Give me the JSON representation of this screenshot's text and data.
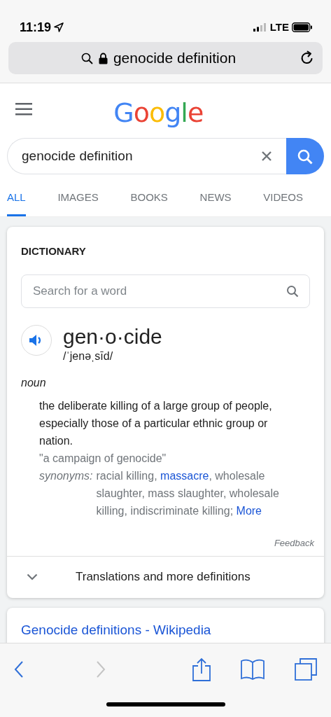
{
  "status_bar": {
    "time": "11:19",
    "network": "LTE"
  },
  "address_bar": {
    "text": "genocide definition",
    "secure": true
  },
  "header": {
    "logo": "Google"
  },
  "search": {
    "value": "genocide definition"
  },
  "tabs": [
    {
      "label": "ALL",
      "selected": true
    },
    {
      "label": "IMAGES",
      "selected": false
    },
    {
      "label": "BOOKS",
      "selected": false
    },
    {
      "label": "NEWS",
      "selected": false
    },
    {
      "label": "VIDEOS",
      "selected": false
    }
  ],
  "dictionary": {
    "title": "DICTIONARY",
    "search_placeholder": "Search for a word",
    "word": "gen·o·cide",
    "pronunciation": "/ˈjenəˌsīd/",
    "part_of_speech": "noun",
    "definition": "the deliberate killing of a large group of people, especially those of a particular ethnic group or nation.",
    "example": "\"a campaign of genocide\"",
    "synonyms_label": "synonyms:",
    "synonyms": [
      {
        "text": "racial killing, ",
        "link": false
      },
      {
        "text": "massacre",
        "link": true
      },
      {
        "text": ", wholesale slaughter, mass slaughter, wholesale killing, indiscriminate killing; ",
        "link": false
      },
      {
        "text": "More",
        "link": true
      }
    ],
    "feedback": "Feedback",
    "more_definitions": "Translations and more definitions"
  },
  "results": [
    {
      "title": "Genocide definitions - Wikipedia"
    }
  ]
}
